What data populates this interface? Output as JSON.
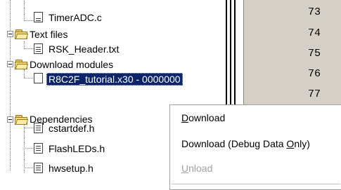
{
  "tree": {
    "items": [
      {
        "label": "TimerADC.c",
        "kind": "c-file-icon"
      },
      {
        "label": "Text files",
        "kind": "folder-icon"
      },
      {
        "label": "RSK_Header.txt",
        "kind": "text-file-icon"
      },
      {
        "label": "Download modules",
        "kind": "folder-icon"
      },
      {
        "label": "R8C2F_tutorial.x30 - 0000000",
        "kind": "module-file-icon",
        "selected": true
      },
      {
        "label": "Dependencies",
        "kind": "folder-icon"
      },
      {
        "label": "cstartdef.h",
        "kind": "header-file-icon"
      },
      {
        "label": "FlashLEDs.h",
        "kind": "header-file-icon"
      },
      {
        "label": "hwsetup.h",
        "kind": "header-file-icon"
      }
    ]
  },
  "editor": {
    "line_numbers": [
      "73",
      "74",
      "75",
      "76",
      "77"
    ]
  },
  "context_menu": {
    "items": [
      {
        "label": "Download",
        "mnemonic": "D",
        "enabled": true
      },
      {
        "label": "Download (Debug Data Only)",
        "mnemonic": "O",
        "enabled": true
      },
      {
        "label": "Unload",
        "mnemonic": "U",
        "enabled": false
      }
    ]
  },
  "colors": {
    "selection_bg": "#0a246a",
    "folder": "#f5d978",
    "gutter_bg": "#d4d0c8",
    "disabled_text": "#a0a0a0"
  }
}
